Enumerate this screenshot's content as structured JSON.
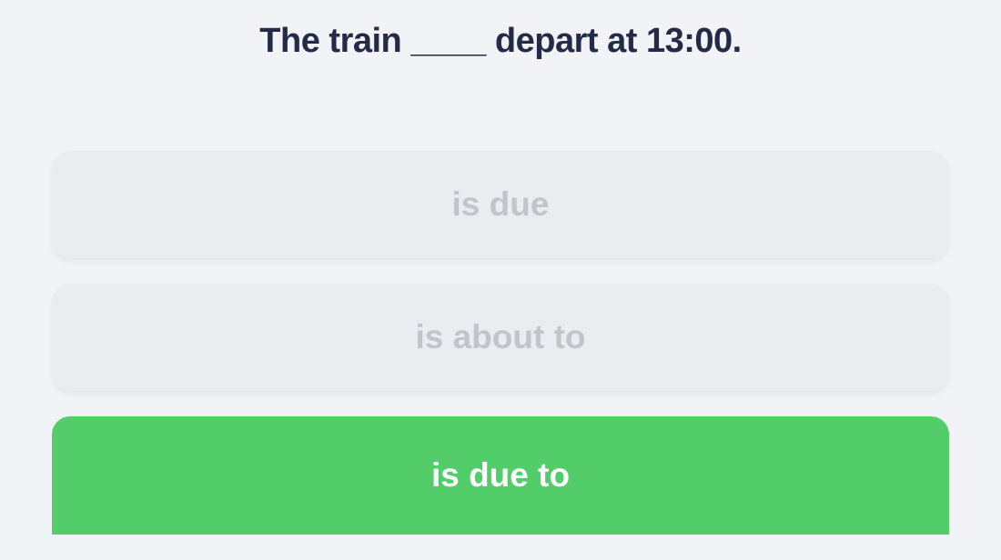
{
  "question": {
    "text": "The train ____ depart at 13:00."
  },
  "options": [
    {
      "label": "is due",
      "state": "disabled"
    },
    {
      "label": "is about to",
      "state": "disabled"
    },
    {
      "label": "is due to",
      "state": "correct"
    }
  ],
  "colors": {
    "background": "#f2f3f6",
    "question_text": "#232b47",
    "option_bg": "#ebecef",
    "option_text_disabled": "#c3c4cb",
    "correct_bg": "#52cd69",
    "correct_text": "#ffffff"
  }
}
